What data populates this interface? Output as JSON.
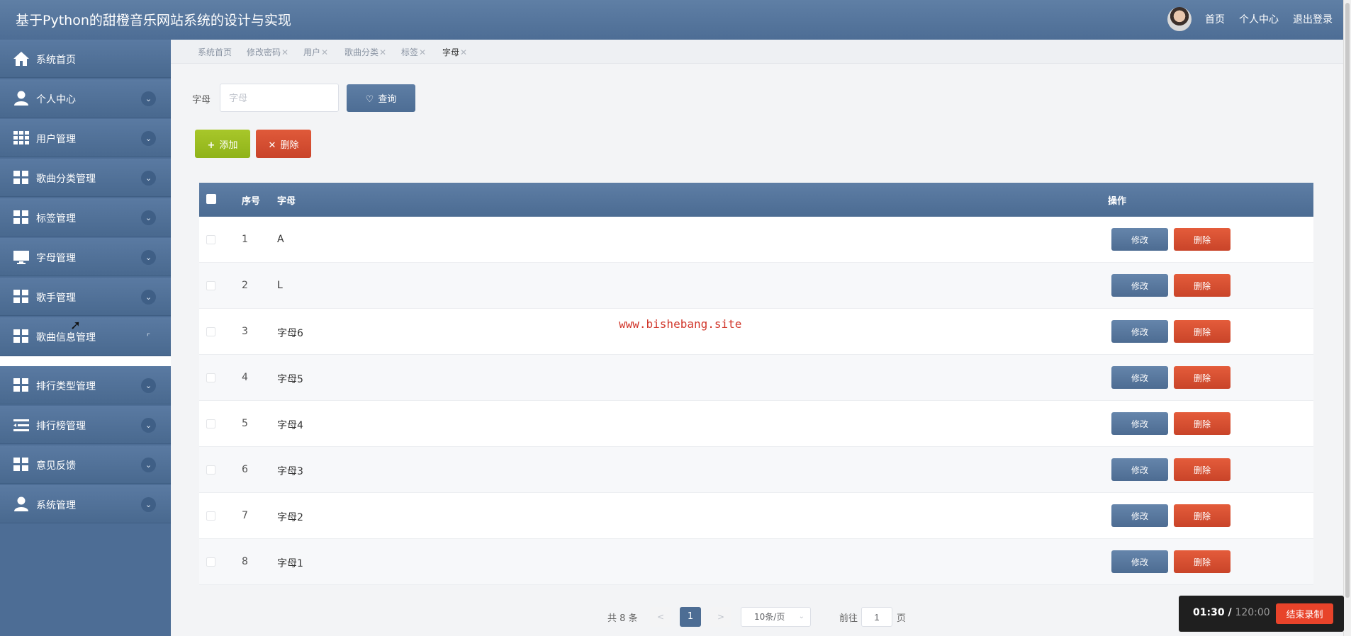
{
  "header": {
    "title": "基于Python的甜橙音乐网站系统的设计与实现",
    "nav": [
      "首页",
      "个人中心",
      "退出登录"
    ]
  },
  "sidebar": {
    "items": [
      {
        "label": "系统首页",
        "icon": "home-icon",
        "has_chevron": false
      },
      {
        "label": "个人中心",
        "icon": "user-icon",
        "has_chevron": true
      },
      {
        "label": "用户管理",
        "icon": "grid-icon",
        "has_chevron": true
      },
      {
        "label": "歌曲分类管理",
        "icon": "grid-icon",
        "has_chevron": true
      },
      {
        "label": "标签管理",
        "icon": "grid-icon",
        "has_chevron": true
      },
      {
        "label": "字母管理",
        "icon": "monitor-icon",
        "has_chevron": true
      },
      {
        "label": "歌手管理",
        "icon": "grid-icon",
        "has_chevron": true
      },
      {
        "label": "歌曲信息管理",
        "icon": "grid-icon",
        "has_chevron": true
      },
      {
        "label": "排行类型管理",
        "icon": "grid-icon",
        "has_chevron": true
      },
      {
        "label": "排行榜管理",
        "icon": "list-icon",
        "has_chevron": true
      },
      {
        "label": "意见反馈",
        "icon": "grid-icon",
        "has_chevron": true
      },
      {
        "label": "系统管理",
        "icon": "user-icon",
        "has_chevron": true
      }
    ]
  },
  "tabs": [
    {
      "label": "系统首页",
      "closable": false
    },
    {
      "label": "修改密码",
      "closable": true
    },
    {
      "label": "用户",
      "closable": true
    },
    {
      "label": "歌曲分类",
      "closable": true
    },
    {
      "label": "标签",
      "closable": true
    },
    {
      "label": "字母",
      "closable": true,
      "active": true
    }
  ],
  "search": {
    "label": "字母",
    "placeholder": "字母",
    "value": "",
    "button_label": "查询"
  },
  "actions": {
    "add_label": "添加",
    "delete_label": "删除"
  },
  "table": {
    "columns": [
      "序号",
      "字母",
      "操作"
    ],
    "rows": [
      {
        "index": "1",
        "letter": "A"
      },
      {
        "index": "2",
        "letter": "L"
      },
      {
        "index": "3",
        "letter": "字母6"
      },
      {
        "index": "4",
        "letter": "字母5"
      },
      {
        "index": "5",
        "letter": "字母4"
      },
      {
        "index": "6",
        "letter": "字母3"
      },
      {
        "index": "7",
        "letter": "字母2"
      },
      {
        "index": "8",
        "letter": "字母1"
      }
    ],
    "edit_label": "修改",
    "delete_label": "删除"
  },
  "watermark": "www.bishebang.site",
  "pagination": {
    "total_text": "共 8 条",
    "prev": "<",
    "current_page": "1",
    "next": ">",
    "page_size": "10条/页",
    "goto_prefix": "前往",
    "goto_value": "1",
    "goto_suffix": "页"
  },
  "recorder": {
    "elapsed": "01:30 /",
    "total": "120:00",
    "stop_label": "结束录制"
  },
  "colors": {
    "primary": "#4d6d95",
    "add": "#9bbd22",
    "danger": "#d34d31"
  }
}
